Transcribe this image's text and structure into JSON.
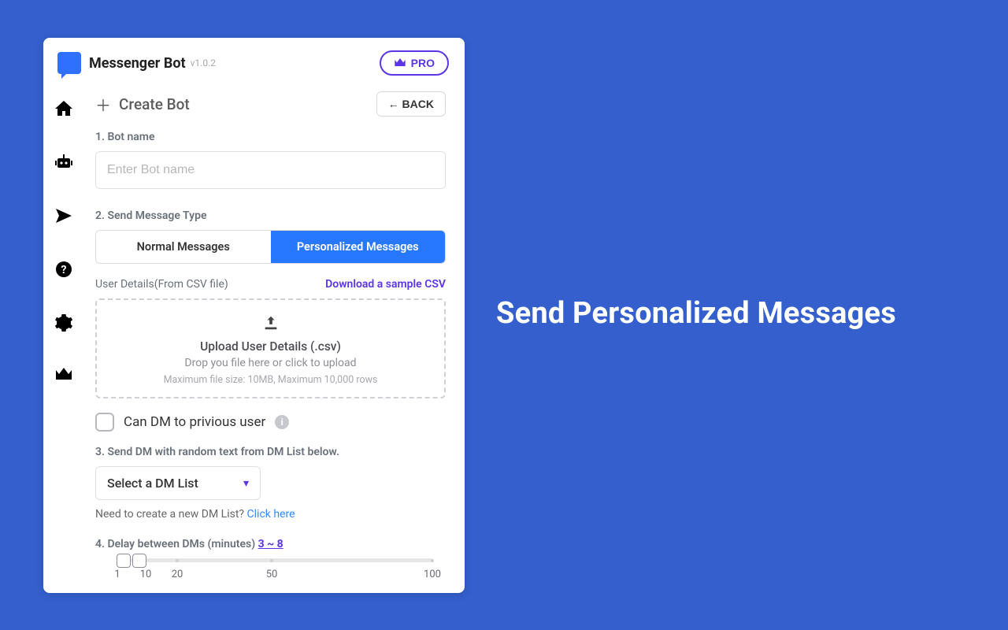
{
  "hero": "Send Personalized Messages",
  "header": {
    "app_name": "Messenger Bot",
    "version": "v1.0.2",
    "pro_label": "PRO"
  },
  "top": {
    "create_label": "Create Bot",
    "back_label": "BACK"
  },
  "form": {
    "name_label": "1. Bot name",
    "name_placeholder": "Enter Bot name",
    "type_label": "2. Send Message Type",
    "type_normal": "Normal Messages",
    "type_personal": "Personalized Messages",
    "userdet_label": "User Details(From CSV file)",
    "dl_sample": "Download a sample CSV",
    "dz_title": "Upload User Details (.csv)",
    "dz_sub": "Drop you file here or click to upload",
    "dz_note": "Maximum file size: 10MB, Maximum 10,000 rows",
    "dm_prev": "Can DM to privious user",
    "dmlist_label": "3. Send DM with random text from DM List below.",
    "dmlist_select": "Select a DM List",
    "need_text": "Need to create a new DM List?  ",
    "need_link": "Click here",
    "delay_label": "4. Delay between DMs (minutes) ",
    "delay_value": "3 ~ 8",
    "ticks": [
      "1",
      "10",
      "20",
      "50",
      "100"
    ]
  }
}
